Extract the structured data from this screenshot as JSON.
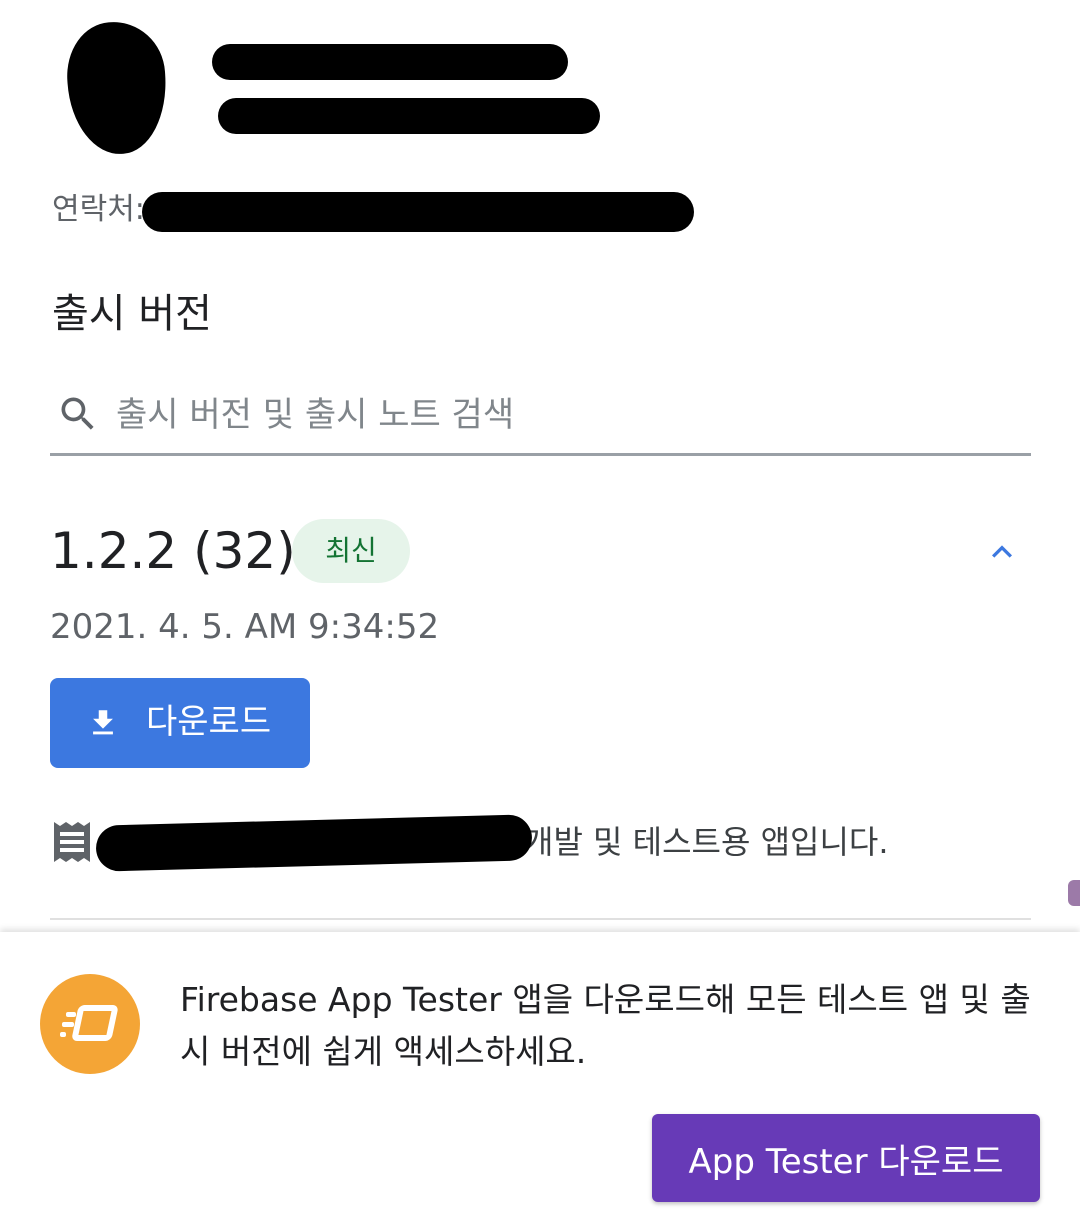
{
  "contact": {
    "label": "연락처:"
  },
  "releases": {
    "title": "출시 버전",
    "search": {
      "placeholder": "출시 버전 및 출시 노트 검색",
      "value": ""
    }
  },
  "release": {
    "version": "1.2.2 (32)",
    "badge": "최신",
    "date": "2021. 4. 5. AM 9:34:52",
    "download_label": "다운로드",
    "notes_visible_text": "개발 및 테스트용 앱입니다."
  },
  "banner": {
    "message": "Firebase App Tester 앱을 다운로드해 모든 테스트 앱 및 출시 버전에 쉽게 액세스하세요.",
    "button_label": "App Tester 다운로드"
  },
  "colors": {
    "primary_blue": "#3c78e0",
    "badge_bg": "#e6f4ea",
    "badge_text": "#137333",
    "banner_button": "#673ab7",
    "app_logo": "#f4a536"
  },
  "icons": [
    "search-icon",
    "chevron-up-icon",
    "download-icon",
    "notes-icon",
    "app-tester-logo-icon"
  ]
}
